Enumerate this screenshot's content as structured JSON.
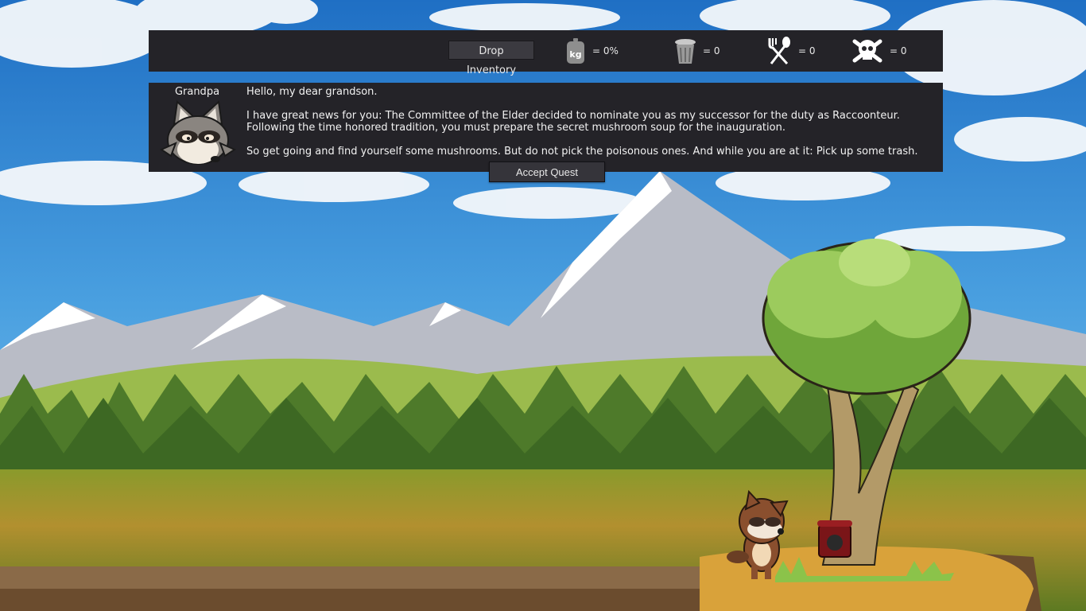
{
  "hud": {
    "drop_label": "Drop Inventory",
    "weight_icon_text": "kg",
    "weight_value": "= 0%",
    "trash_value": "= 0",
    "food_value": "= 0",
    "poison_value": "= 0"
  },
  "dialog": {
    "speaker": "Grandpa",
    "greeting": "Hello, my dear grandson.",
    "line1": "I have great news for you: The Committee of the Elder decided to nominate you as my successor for the duty as Raccoonteur.",
    "line2": "Following the time honored tradition, you must prepare the secret mushroom soup for the inauguration.",
    "line3": "So get going and find yourself some mushrooms. But do not pick the poisonous ones. And while you are at it: Pick up some trash."
  },
  "accept_label": "Accept Quest",
  "icons": {
    "weight": "weight-icon",
    "trash": "trash-can-icon",
    "food": "fork-spoon-icon",
    "poison": "skull-crossbones-icon"
  },
  "colors": {
    "panel": "#242328",
    "sky": "#3a8ed4",
    "grass": "#6b8a2c"
  }
}
